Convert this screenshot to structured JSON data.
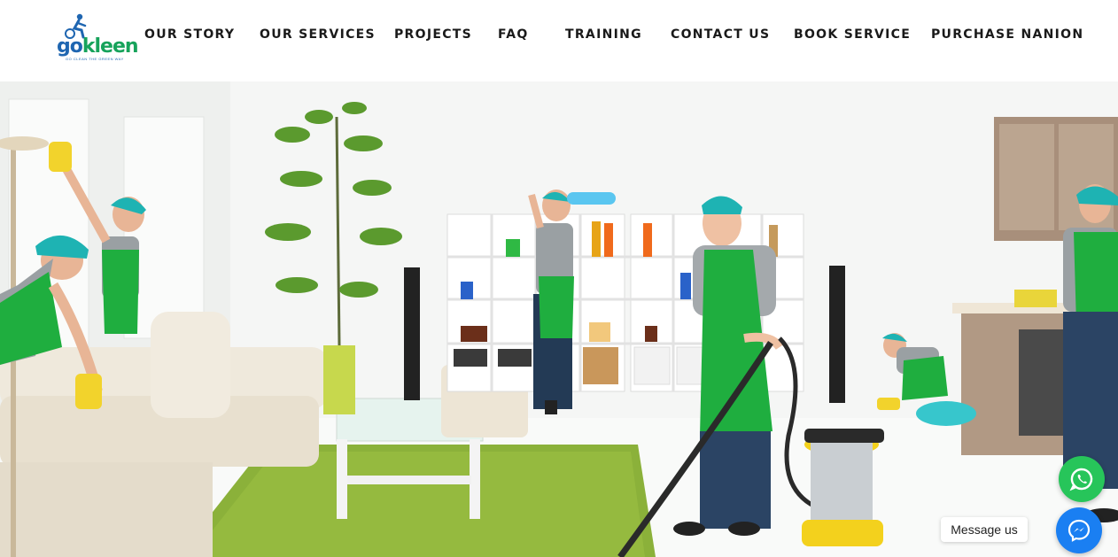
{
  "logo": {
    "part1": "go",
    "part2": "kleen",
    "tagline": "GO CLEAN THE GREEN WAY"
  },
  "nav": {
    "items": [
      {
        "label": "OUR STORY"
      },
      {
        "label": "OUR SERVICES"
      },
      {
        "label": "PROJECTS"
      },
      {
        "label": "FAQ"
      },
      {
        "label": "TRAINING"
      },
      {
        "label": "CONTACT US"
      },
      {
        "label": "BOOK SERVICE"
      },
      {
        "label": "PURCHASE NANION"
      }
    ]
  },
  "floating": {
    "whatsapp_icon": "whatsapp-icon",
    "messenger_icon": "messenger-icon",
    "messenger_label": "Message us"
  },
  "colors": {
    "brand_blue": "#1f66b1",
    "brand_green": "#17a35b",
    "whatsapp": "#27c55a",
    "messenger": "#1a7ff2",
    "apron_green": "#1fae3f"
  }
}
